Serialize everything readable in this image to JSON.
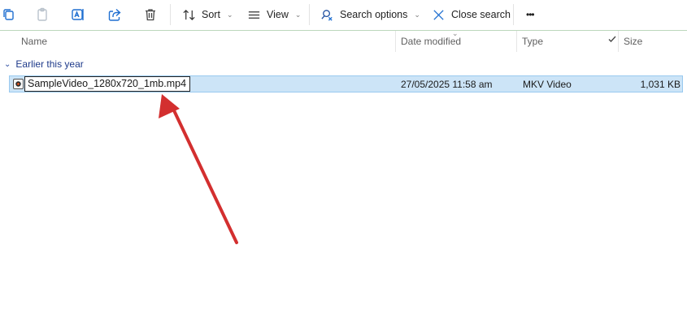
{
  "toolbar": {
    "sort_label": "Sort",
    "view_label": "View",
    "search_options_label": "Search options",
    "close_search_label": "Close search",
    "more_label": "•••",
    "dropdown_chevron": "⌄"
  },
  "columns": {
    "name": "Name",
    "date_modified": "Date modified",
    "type": "Type",
    "size": "Size"
  },
  "group": {
    "label": "Earlier this year",
    "chevron": "⌄"
  },
  "file": {
    "rename_value": "SampleVideo_1280x720_1mb.mp4",
    "date_modified": "27/05/2025 11:58 am",
    "type": "MKV Video",
    "size": "1,031 KB"
  },
  "colors": {
    "selection_fill": "#cce4f7",
    "selection_border": "#99c9ef",
    "group_text": "#1e3a8a",
    "annotation_arrow": "#d32f2f"
  },
  "icons": [
    "copy-icon",
    "paste-icon",
    "rename-icon",
    "share-icon",
    "delete-icon",
    "sort-icon",
    "view-icon",
    "search-options-icon",
    "close-icon",
    "more-icon",
    "video-file-icon",
    "checkmark-icon"
  ]
}
